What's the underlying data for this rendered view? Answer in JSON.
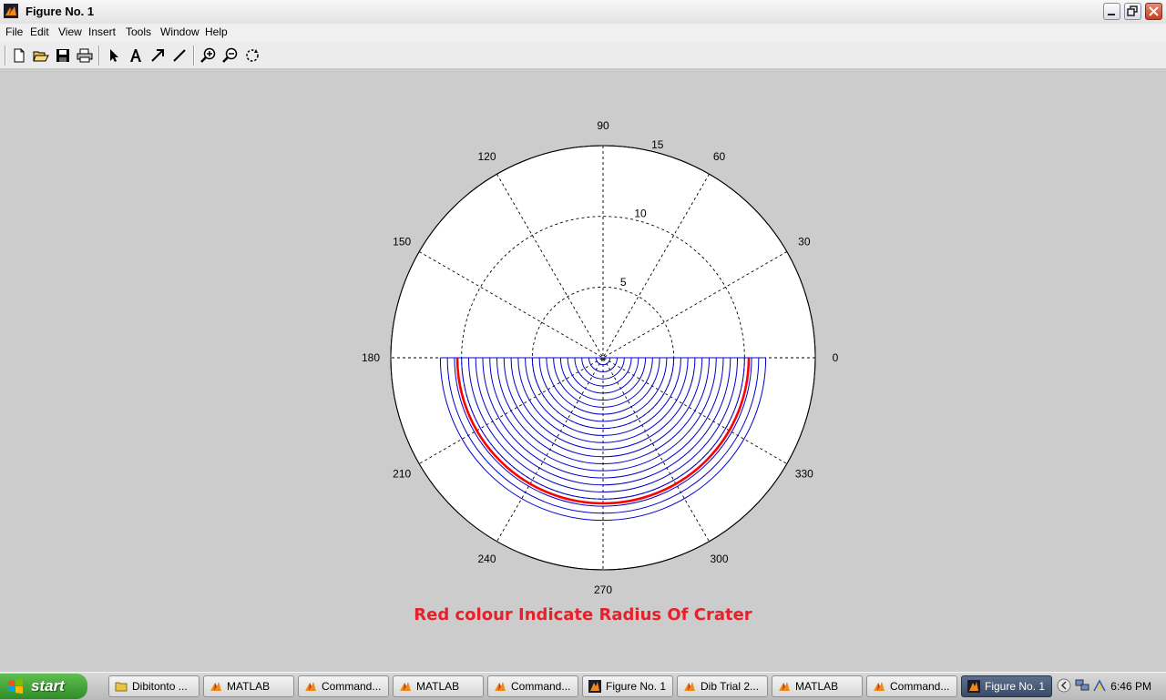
{
  "window": {
    "title": "Figure No. 1"
  },
  "menu": [
    "File",
    "Edit",
    "View",
    "Insert",
    "Tools",
    "Window",
    "Help"
  ],
  "toolbar": [
    {
      "name": "new-figure-icon"
    },
    {
      "name": "open-file-icon"
    },
    {
      "name": "save-icon"
    },
    {
      "name": "print-icon"
    },
    {
      "name": "edit-plot-arrow-icon"
    },
    {
      "name": "insert-text-icon"
    },
    {
      "name": "insert-arrow-icon"
    },
    {
      "name": "insert-line-icon"
    },
    {
      "name": "zoom-in-icon"
    },
    {
      "name": "zoom-out-icon"
    },
    {
      "name": "rotate-3d-icon"
    }
  ],
  "chart_data": {
    "type": "polar",
    "title": "",
    "angle_labels": [
      "0",
      "30",
      "60",
      "90",
      "120",
      "150",
      "180",
      "210",
      "240",
      "270",
      "300",
      "330"
    ],
    "radial_ticks": [
      5,
      10,
      15
    ],
    "rmax": 15,
    "series": [
      {
        "color": "#0000cc",
        "theta_range_deg": [
          180,
          360
        ],
        "radii": [
          0.5,
          1,
          1.5,
          2,
          2.5,
          3,
          3.5,
          4,
          4.5,
          5,
          5.5,
          6,
          6.5,
          7,
          7.5,
          8,
          8.5,
          9,
          9.5,
          10,
          10.5,
          11,
          11.5
        ]
      },
      {
        "color": "#ff0000",
        "theta_range_deg": [
          180,
          360
        ],
        "radii": [
          10.3
        ]
      }
    ]
  },
  "caption": "Red colour Indicate Radius Of Crater",
  "taskbar": {
    "start_label": "start",
    "buttons": [
      {
        "label": "Dibitonto ...",
        "icon": "folder-icon"
      },
      {
        "label": "MATLAB",
        "icon": "matlab-icon"
      },
      {
        "label": "Command...",
        "icon": "matlab-icon"
      },
      {
        "label": "MATLAB",
        "icon": "matlab-icon"
      },
      {
        "label": "Command...",
        "icon": "matlab-icon"
      },
      {
        "label": "Figure No. 1",
        "icon": "matlab-figure-icon"
      },
      {
        "label": "Dib Trial 2...",
        "icon": "matlab-icon"
      },
      {
        "label": "MATLAB",
        "icon": "matlab-icon"
      },
      {
        "label": "Command...",
        "icon": "matlab-icon"
      },
      {
        "label": "Figure No. 1",
        "icon": "matlab-figure-icon",
        "active": true
      }
    ],
    "clock": "6:46 PM"
  }
}
